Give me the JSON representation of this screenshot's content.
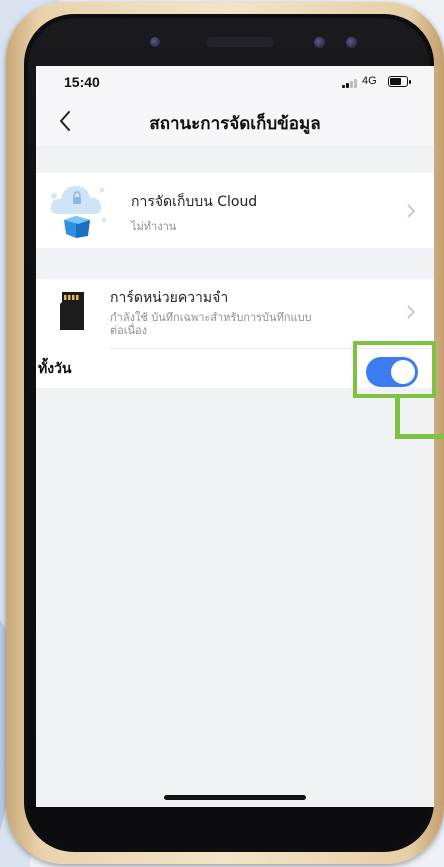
{
  "status_bar": {
    "time": "15:40",
    "network": "4G"
  },
  "header": {
    "title": "สถานะการจัดเก็บข้อมูล",
    "back_icon": "chevron-left-icon"
  },
  "cloud": {
    "title": "การจัดเก็บบน Cloud",
    "subtitle": "ไม่ทำงาน",
    "icon": "cloud-storage-icon"
  },
  "sd_card": {
    "title": "การ์ดหน่วยความจำ",
    "subtitle_line1": "กำลังใช้ บันทึกเฉพาะสำหรับการบันทึกแบบ",
    "subtitle_line2": "ต่อเนื่อง",
    "icon": "sd-card-icon"
  },
  "all_day": {
    "label": "ทั้งวัน",
    "enabled": true
  },
  "colors": {
    "accent": "#3b7df0",
    "highlight": "#7dc241",
    "background": "#f1f2f6"
  }
}
